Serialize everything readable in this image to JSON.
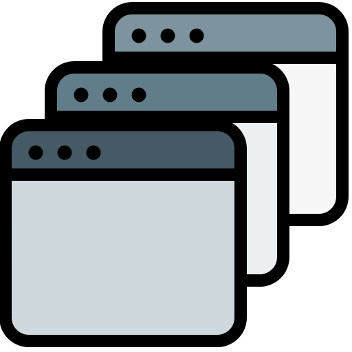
{
  "icon": "stacked-windows-icon",
  "windows": [
    {
      "name": "window-back",
      "icon": "browser-window-icon",
      "header_color": "#7D939E",
      "body_color": "#F7F7F7"
    },
    {
      "name": "window-middle",
      "icon": "browser-window-icon",
      "header_color": "#627D8A",
      "body_color": "#ECEFF1"
    },
    {
      "name": "window-front",
      "icon": "browser-window-icon",
      "header_color": "#455A64",
      "body_color": "#CFD8DC"
    }
  ],
  "colors": {
    "outline": "#000000",
    "dot": "#000000"
  }
}
